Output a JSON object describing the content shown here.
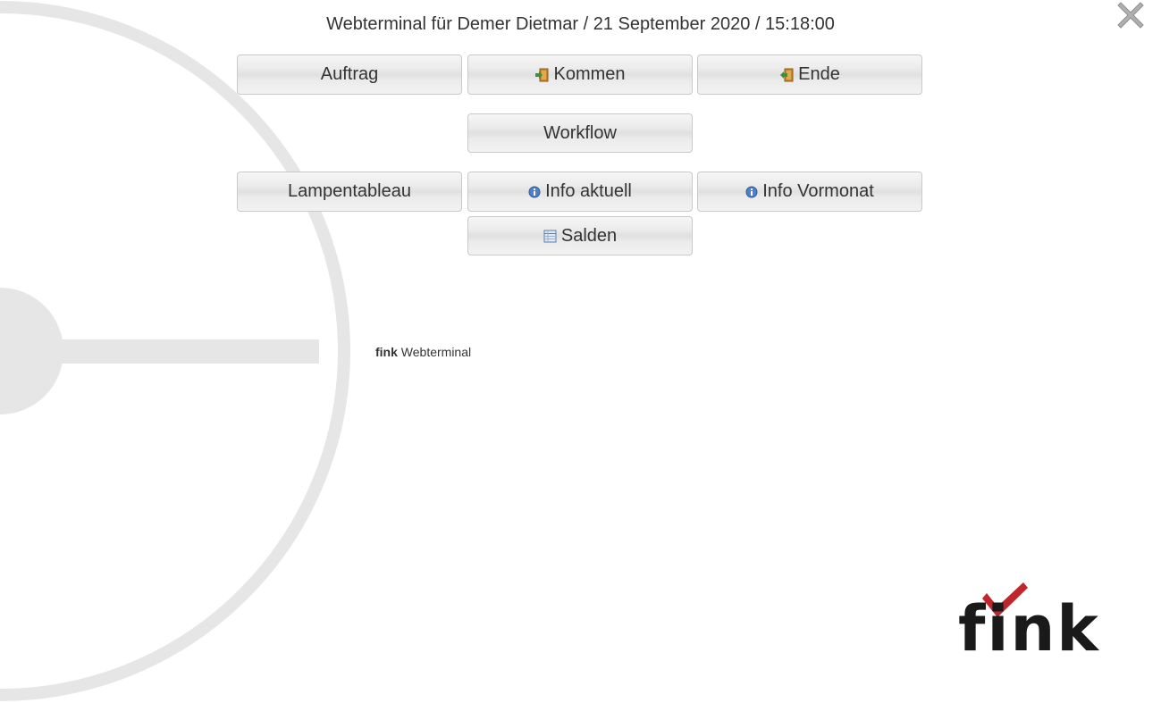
{
  "header": {
    "title": "Webterminal für Demer Dietmar / 21 September 2020 / 15:18:00"
  },
  "close": {
    "icon": "close-icon"
  },
  "buttons": {
    "auftrag": {
      "label": "Auftrag"
    },
    "kommen": {
      "label": "Kommen",
      "icon": "door-enter-icon"
    },
    "ende": {
      "label": "Ende",
      "icon": "door-exit-icon"
    },
    "workflow": {
      "label": "Workflow"
    },
    "lampentableau": {
      "label": "Lampentableau"
    },
    "info_aktuell": {
      "label": "Info aktuell",
      "icon": "info-icon"
    },
    "info_vormonat": {
      "label": "Info Vormonat",
      "icon": "info-icon"
    },
    "salden": {
      "label": "Salden",
      "icon": "table-icon"
    }
  },
  "footer": {
    "brand": "fink",
    "product": "Webterminal"
  },
  "logo": {
    "text": "fink",
    "icon": "checkmark-icon",
    "check_color": "#c0272d",
    "text_color": "#1a1a1a"
  },
  "colors": {
    "background": "#ffffff",
    "clock_graphic": "#e6e6e6",
    "button_border": "#c9c9c9",
    "text": "#333333"
  }
}
